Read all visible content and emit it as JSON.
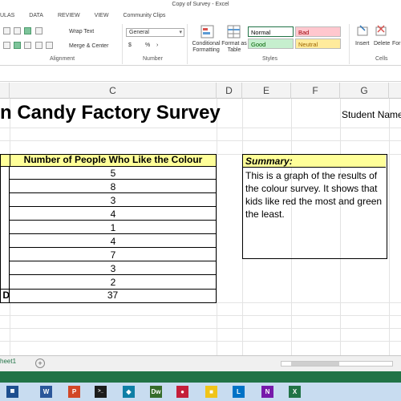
{
  "window": {
    "title": "Copy of Survey - Excel"
  },
  "ribbon_tabs": [
    "ULAS",
    "DATA",
    "REVIEW",
    "VIEW",
    "Community Clips"
  ],
  "ribbon": {
    "wrap_text": "Wrap Text",
    "merge_center": "Merge & Center",
    "number_format": "General",
    "currency_symbol": "$",
    "percent_symbol": "%",
    "comma_symbol": "›",
    "conditional_formatting": "Conditional Formatting",
    "format_as_table": "Format as Table",
    "styles": {
      "normal": "Normal",
      "bad": "Bad",
      "good": "Good",
      "neutral": "Neutral"
    },
    "insert": "Insert",
    "delete": "Delete",
    "format_partial": "For",
    "group_labels": {
      "alignment": "Alignment",
      "number": "Number",
      "styles": "Styles",
      "cells": "Cells"
    }
  },
  "columns": [
    "C",
    "D",
    "E",
    "F",
    "G"
  ],
  "sheet": {
    "title": "n Candy Factory Survey",
    "student_label": "Student Name",
    "table": {
      "header": "Number of People Who Like the Colour",
      "values": [
        "5",
        "8",
        "3",
        "4",
        "1",
        "4",
        "7",
        "3",
        "2"
      ],
      "total_label_partial": "D",
      "total": "37"
    },
    "summary": {
      "title": "Summary:",
      "text": "This is a graph of the results of the colour survey. It shows that kids like red the most and green the least."
    }
  },
  "sheet_tabs": {
    "active": "heet1"
  },
  "taskbar": [
    "W",
    "P",
    ">_",
    "Dw",
    "N",
    "X"
  ],
  "colors": {
    "excel_green": "#217346",
    "header_yellow": "#ffff99",
    "good_green": "#c6efce",
    "bad_red": "#ffc7ce",
    "neutral_yellow": "#ffeb9c"
  }
}
